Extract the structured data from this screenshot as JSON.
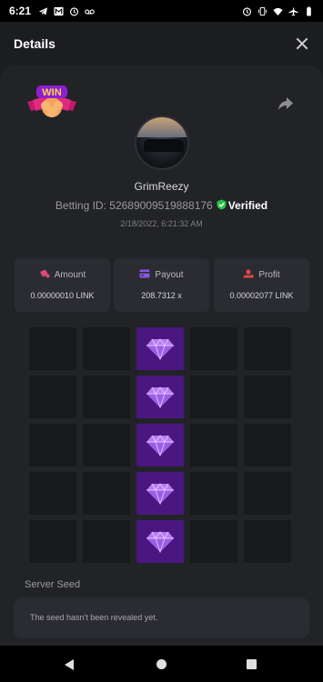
{
  "status_bar": {
    "time": "6:21",
    "icons_left": [
      "telegram-icon",
      "m-app-icon",
      "alarm-icon",
      "voicemail-icon"
    ],
    "icons_right": [
      "alarm-icon",
      "vibrate-icon",
      "wifi-icon",
      "airplane-icon",
      "battery-icon"
    ]
  },
  "header": {
    "title": "Details"
  },
  "badge": {
    "text": "WIN"
  },
  "user": {
    "name": "GrimReezy",
    "betting_id_label": "Betting ID:",
    "betting_id": "52689009519888176",
    "verified_label": "Verified",
    "date": "2/18/2022, 6:21:32 AM"
  },
  "stats": [
    {
      "label": "Amount",
      "value": "0.00000010 LINK",
      "icon": "coins-icon",
      "color": "#e0487a"
    },
    {
      "label": "Payout",
      "value": "208.7312 x",
      "icon": "card-icon",
      "color": "#8a55e8"
    },
    {
      "label": "Profit",
      "value": "0.00002077 LINK",
      "icon": "coin-hand-icon",
      "color": "#e04848"
    }
  ],
  "grid": {
    "rows": 5,
    "cols": 5,
    "gem_column": 3
  },
  "server_seed": {
    "label": "Server Seed",
    "message": "The seed hasn't been revealed yet."
  },
  "colors": {
    "accent_purple": "#4a1680",
    "verified_green": "#29c24a"
  }
}
